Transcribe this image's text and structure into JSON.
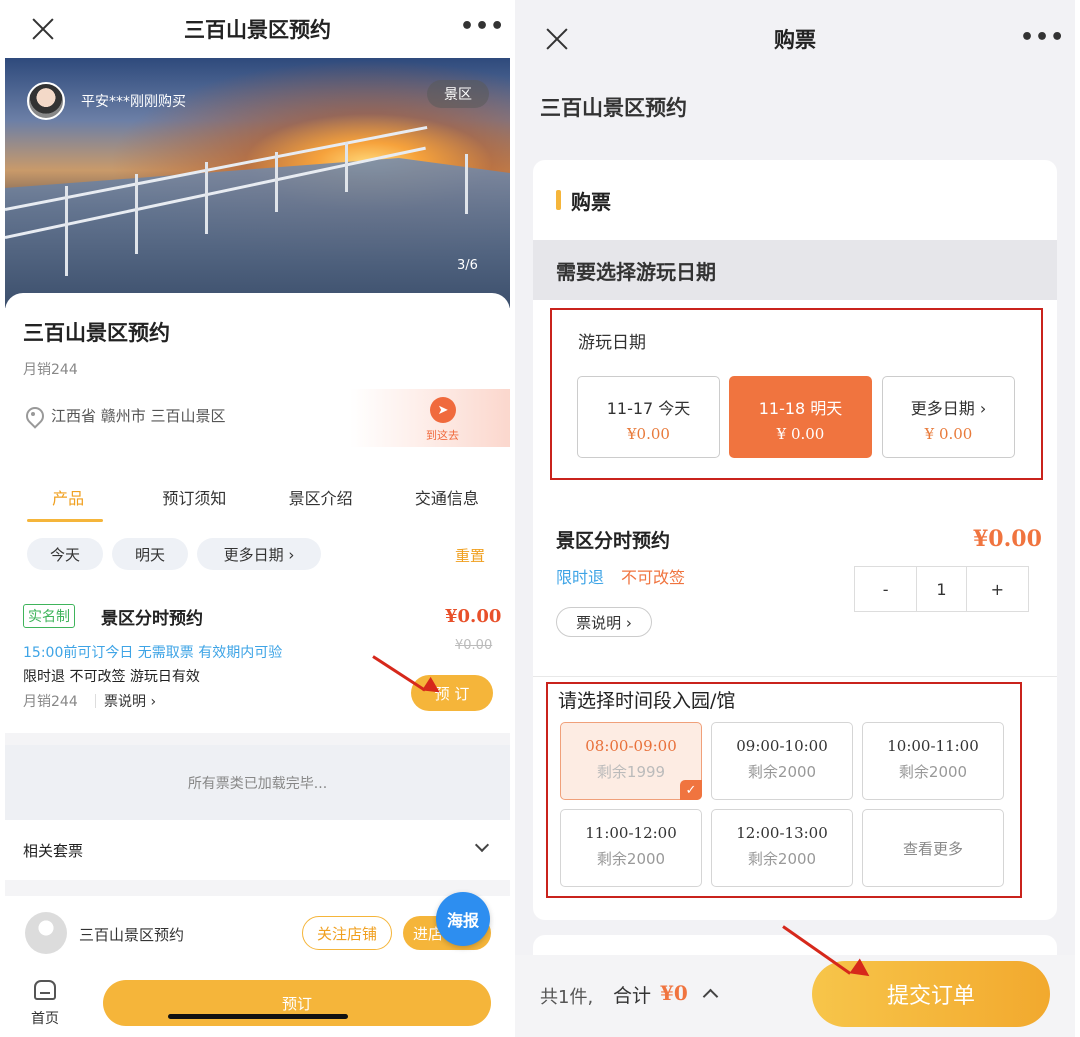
{
  "left": {
    "nav_title": "三百山景区预约",
    "buyer_text": "平安***刚刚购买",
    "scenic_badge": "景区",
    "image_counter": "3/6",
    "product_title": "三百山景区预约",
    "monthly_sales": "月销244",
    "location": "江西省 赣州市 三百山景区",
    "goto_label": "到这去",
    "tabs": [
      "产品",
      "预订须知",
      "景区介绍",
      "交通信息"
    ],
    "date_chips": [
      "今天",
      "明天",
      "更多日期 ›"
    ],
    "reset": "重置",
    "ticket": {
      "realname": "实名制",
      "name": "景区分时预约",
      "price": "¥0.00",
      "old_price": "¥0.00",
      "info_blue": "15:00前可订今日  无需取票  有效期内可验",
      "tags": "限时退  不可改签  游玩日有效",
      "sales": "月销244",
      "desc": "票说明 ›",
      "book_button": "预 订"
    },
    "loaded_text": "所有票类已加载完毕...",
    "bundle_label": "相关套票",
    "store": {
      "name": "三百山景区预约",
      "follow": "关注店铺",
      "enter": "进店"
    },
    "poster_button": "海报",
    "home_label": "首页",
    "reserve_button": "预订"
  },
  "right": {
    "nav_title": "购票",
    "page_heading": "三百山景区预约",
    "section_title": "购票",
    "need_date": "需要选择游玩日期",
    "date_label": "游玩日期",
    "dates": [
      {
        "label": "11-17  今天",
        "price": "¥0.00"
      },
      {
        "label": "11-18  明天",
        "price": "¥ 0.00"
      },
      {
        "label": "更多日期  ›",
        "price": "¥ 0.00"
      }
    ],
    "ticket_name": "景区分时预约",
    "ticket_price": "¥0.00",
    "refund_tag": "限时退",
    "nochange_tag": "不可改签",
    "stepper": {
      "minus": "-",
      "value": "1",
      "plus": "+"
    },
    "ticket_note": "票说明 ›",
    "slot_heading": "请选择时间段入园/馆",
    "slots": [
      {
        "time": "08:00-09:00",
        "remain": "剩余1999"
      },
      {
        "time": "09:00-10:00",
        "remain": "剩余2000"
      },
      {
        "time": "10:00-11:00",
        "remain": "剩余2000"
      },
      {
        "time": "11:00-12:00",
        "remain": "剩余2000"
      },
      {
        "time": "12:00-13:00",
        "remain": "剩余2000"
      },
      {
        "time": "查看更多",
        "remain": ""
      }
    ],
    "total_count": "共1件,",
    "total_label": "合计",
    "total_amount": "¥0",
    "submit_button": "提交订单"
  },
  "colors": {
    "accent_yellow": "#f5b53a",
    "accent_orange": "#f0743f",
    "highlight_red": "#c9231c",
    "link_blue": "#3ea4e6"
  }
}
